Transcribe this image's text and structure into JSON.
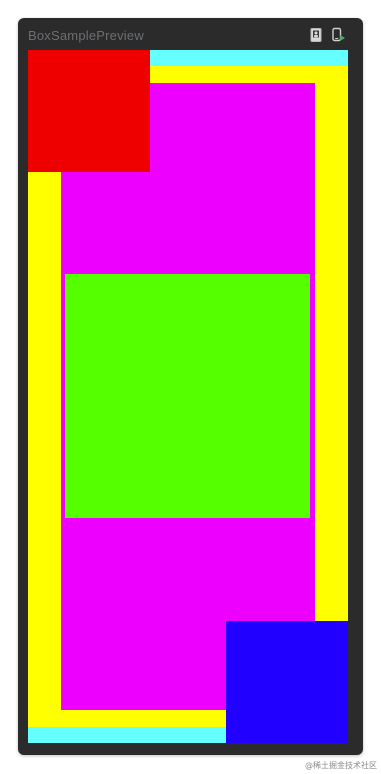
{
  "window": {
    "title": "BoxSamplePreview"
  },
  "toolbar": {
    "device_icon": "device-preview-icon",
    "deploy_icon": "deploy-preview-icon"
  },
  "preview": {
    "colors": {
      "cyan": "#66ffff",
      "yellow": "#ffff00",
      "magenta": "#ee00ff",
      "green": "#55ff00",
      "red": "#ee0000",
      "blue": "#2200ff"
    }
  },
  "watermark": {
    "text": "@稀土掘金技术社区"
  }
}
